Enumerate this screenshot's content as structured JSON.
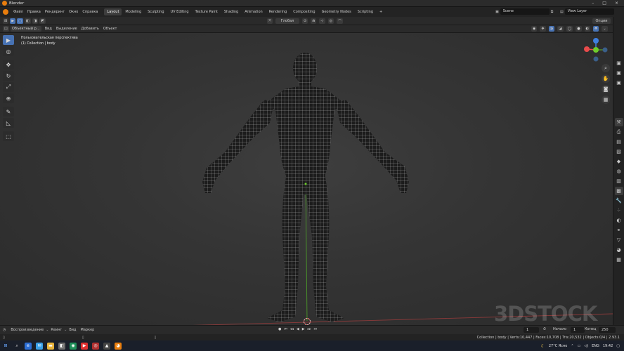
{
  "window": {
    "title": "Blender"
  },
  "menu": [
    "Файл",
    "Правка",
    "Рендеринг",
    "Окно",
    "Справка"
  ],
  "workspaces": [
    "Layout",
    "Modeling",
    "Sculpting",
    "UV Editing",
    "Texture Paint",
    "Shading",
    "Animation",
    "Rendering",
    "Compositing",
    "Geometry Nodes",
    "Scripting"
  ],
  "active_workspace": "Layout",
  "scene": {
    "label": "Scene",
    "view_layer": "View Layer"
  },
  "header1": {
    "transform": "Глобал",
    "options": "Опции"
  },
  "header2": {
    "mode": "Объектный р...",
    "items": [
      "Вид",
      "Выделение",
      "Добавить",
      "Объект"
    ]
  },
  "viewport": {
    "view_name": "Пользовательская перспектива",
    "collection_line": "(1) Collection | body"
  },
  "timeline": {
    "playback": "Воспроизведение",
    "keying": "Кеинг",
    "view": "Вид",
    "marker": "Маркер",
    "current_frame": "1",
    "start_label": "Начало",
    "start": "1",
    "end_label": "Конец",
    "end": "250"
  },
  "status": {
    "info": "Collection | body | Verts:10,447 | Faces:10,708 | Tris:20,532 | Objects:0/4 | 2.93.1"
  },
  "taskbar": {
    "weather": "27°C Ясно",
    "lang": "ENG",
    "time": "19:42"
  },
  "watermark": "3DSTOCK",
  "colors": {
    "accent": "#4772b3",
    "blender_orange": "#e87d0d",
    "axis_x": "#e84b4b",
    "axis_y": "#6ecc2b",
    "axis_z": "#3f7fe0",
    "wire": "#c8c8c8"
  }
}
